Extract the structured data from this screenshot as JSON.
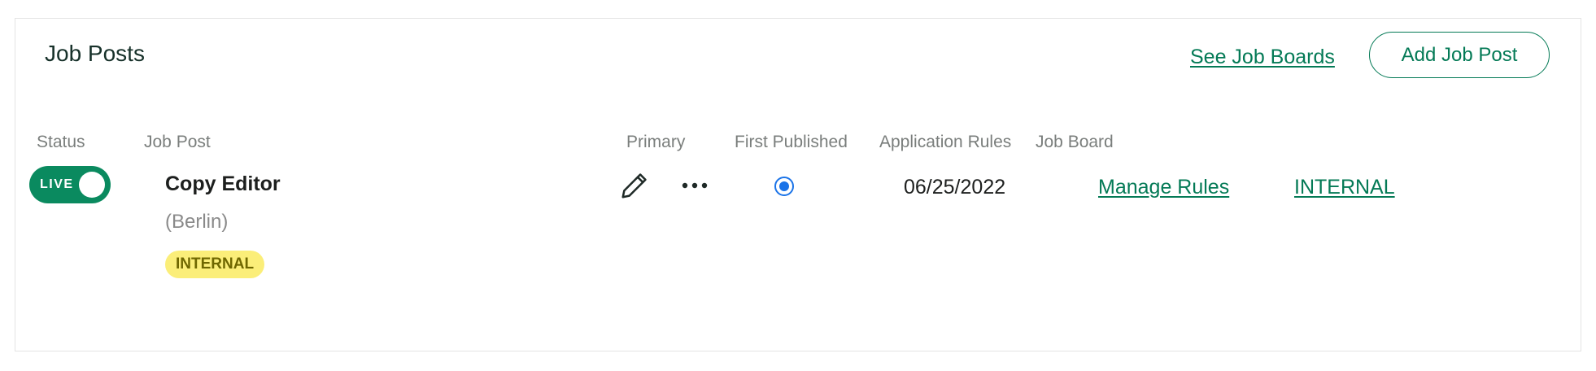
{
  "card": {
    "title": "Job Posts",
    "see_boards_label": "See Job Boards",
    "add_button_label": "Add Job Post"
  },
  "table": {
    "headers": {
      "status": "Status",
      "job_post": "Job Post",
      "primary": "Primary",
      "first_published": "First Published",
      "application_rules": "Application Rules",
      "job_board": "Job Board"
    },
    "rows": [
      {
        "status_toggle_label": "LIVE",
        "status_on": true,
        "title": "Copy Editor",
        "location": "(Berlin)",
        "badge": "INTERNAL",
        "primary_selected": true,
        "first_published": "06/25/2022",
        "application_rules_link": "Manage Rules",
        "job_board_link": "INTERNAL"
      }
    ]
  },
  "icons": {
    "edit": "pencil-icon",
    "more": "more-horizontal-icon"
  },
  "colors": {
    "accent": "#047a56",
    "toggle_bg": "#0a8a5f",
    "badge_bg": "#fbee79",
    "badge_text": "#6f6700",
    "radio": "#1a73e8"
  }
}
